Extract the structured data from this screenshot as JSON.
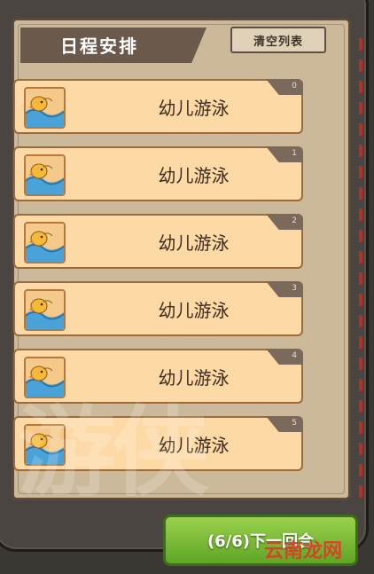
{
  "panel": {
    "title": "日程安排",
    "clear_label": "清空列表"
  },
  "schedule": [
    {
      "index": "0",
      "label": "幼儿游泳",
      "icon": "duck-swimming-icon"
    },
    {
      "index": "1",
      "label": "幼儿游泳",
      "icon": "duck-swimming-icon"
    },
    {
      "index": "2",
      "label": "幼儿游泳",
      "icon": "duck-swimming-icon"
    },
    {
      "index": "3",
      "label": "幼儿游泳",
      "icon": "duck-swimming-icon"
    },
    {
      "index": "4",
      "label": "幼儿游泳",
      "icon": "duck-swimming-icon"
    },
    {
      "index": "5",
      "label": "幼儿游泳",
      "icon": "duck-swimming-icon"
    }
  ],
  "next_button": {
    "label": "(6/6)下一回合"
  },
  "watermark": {
    "site": "云南龙网",
    "overlay": "游侠"
  },
  "colors": {
    "panel_bg": "#cbb999",
    "item_bg": "#fdd9a6",
    "next_green": "#7cbe3a",
    "frame_dash": "#b3302a"
  }
}
